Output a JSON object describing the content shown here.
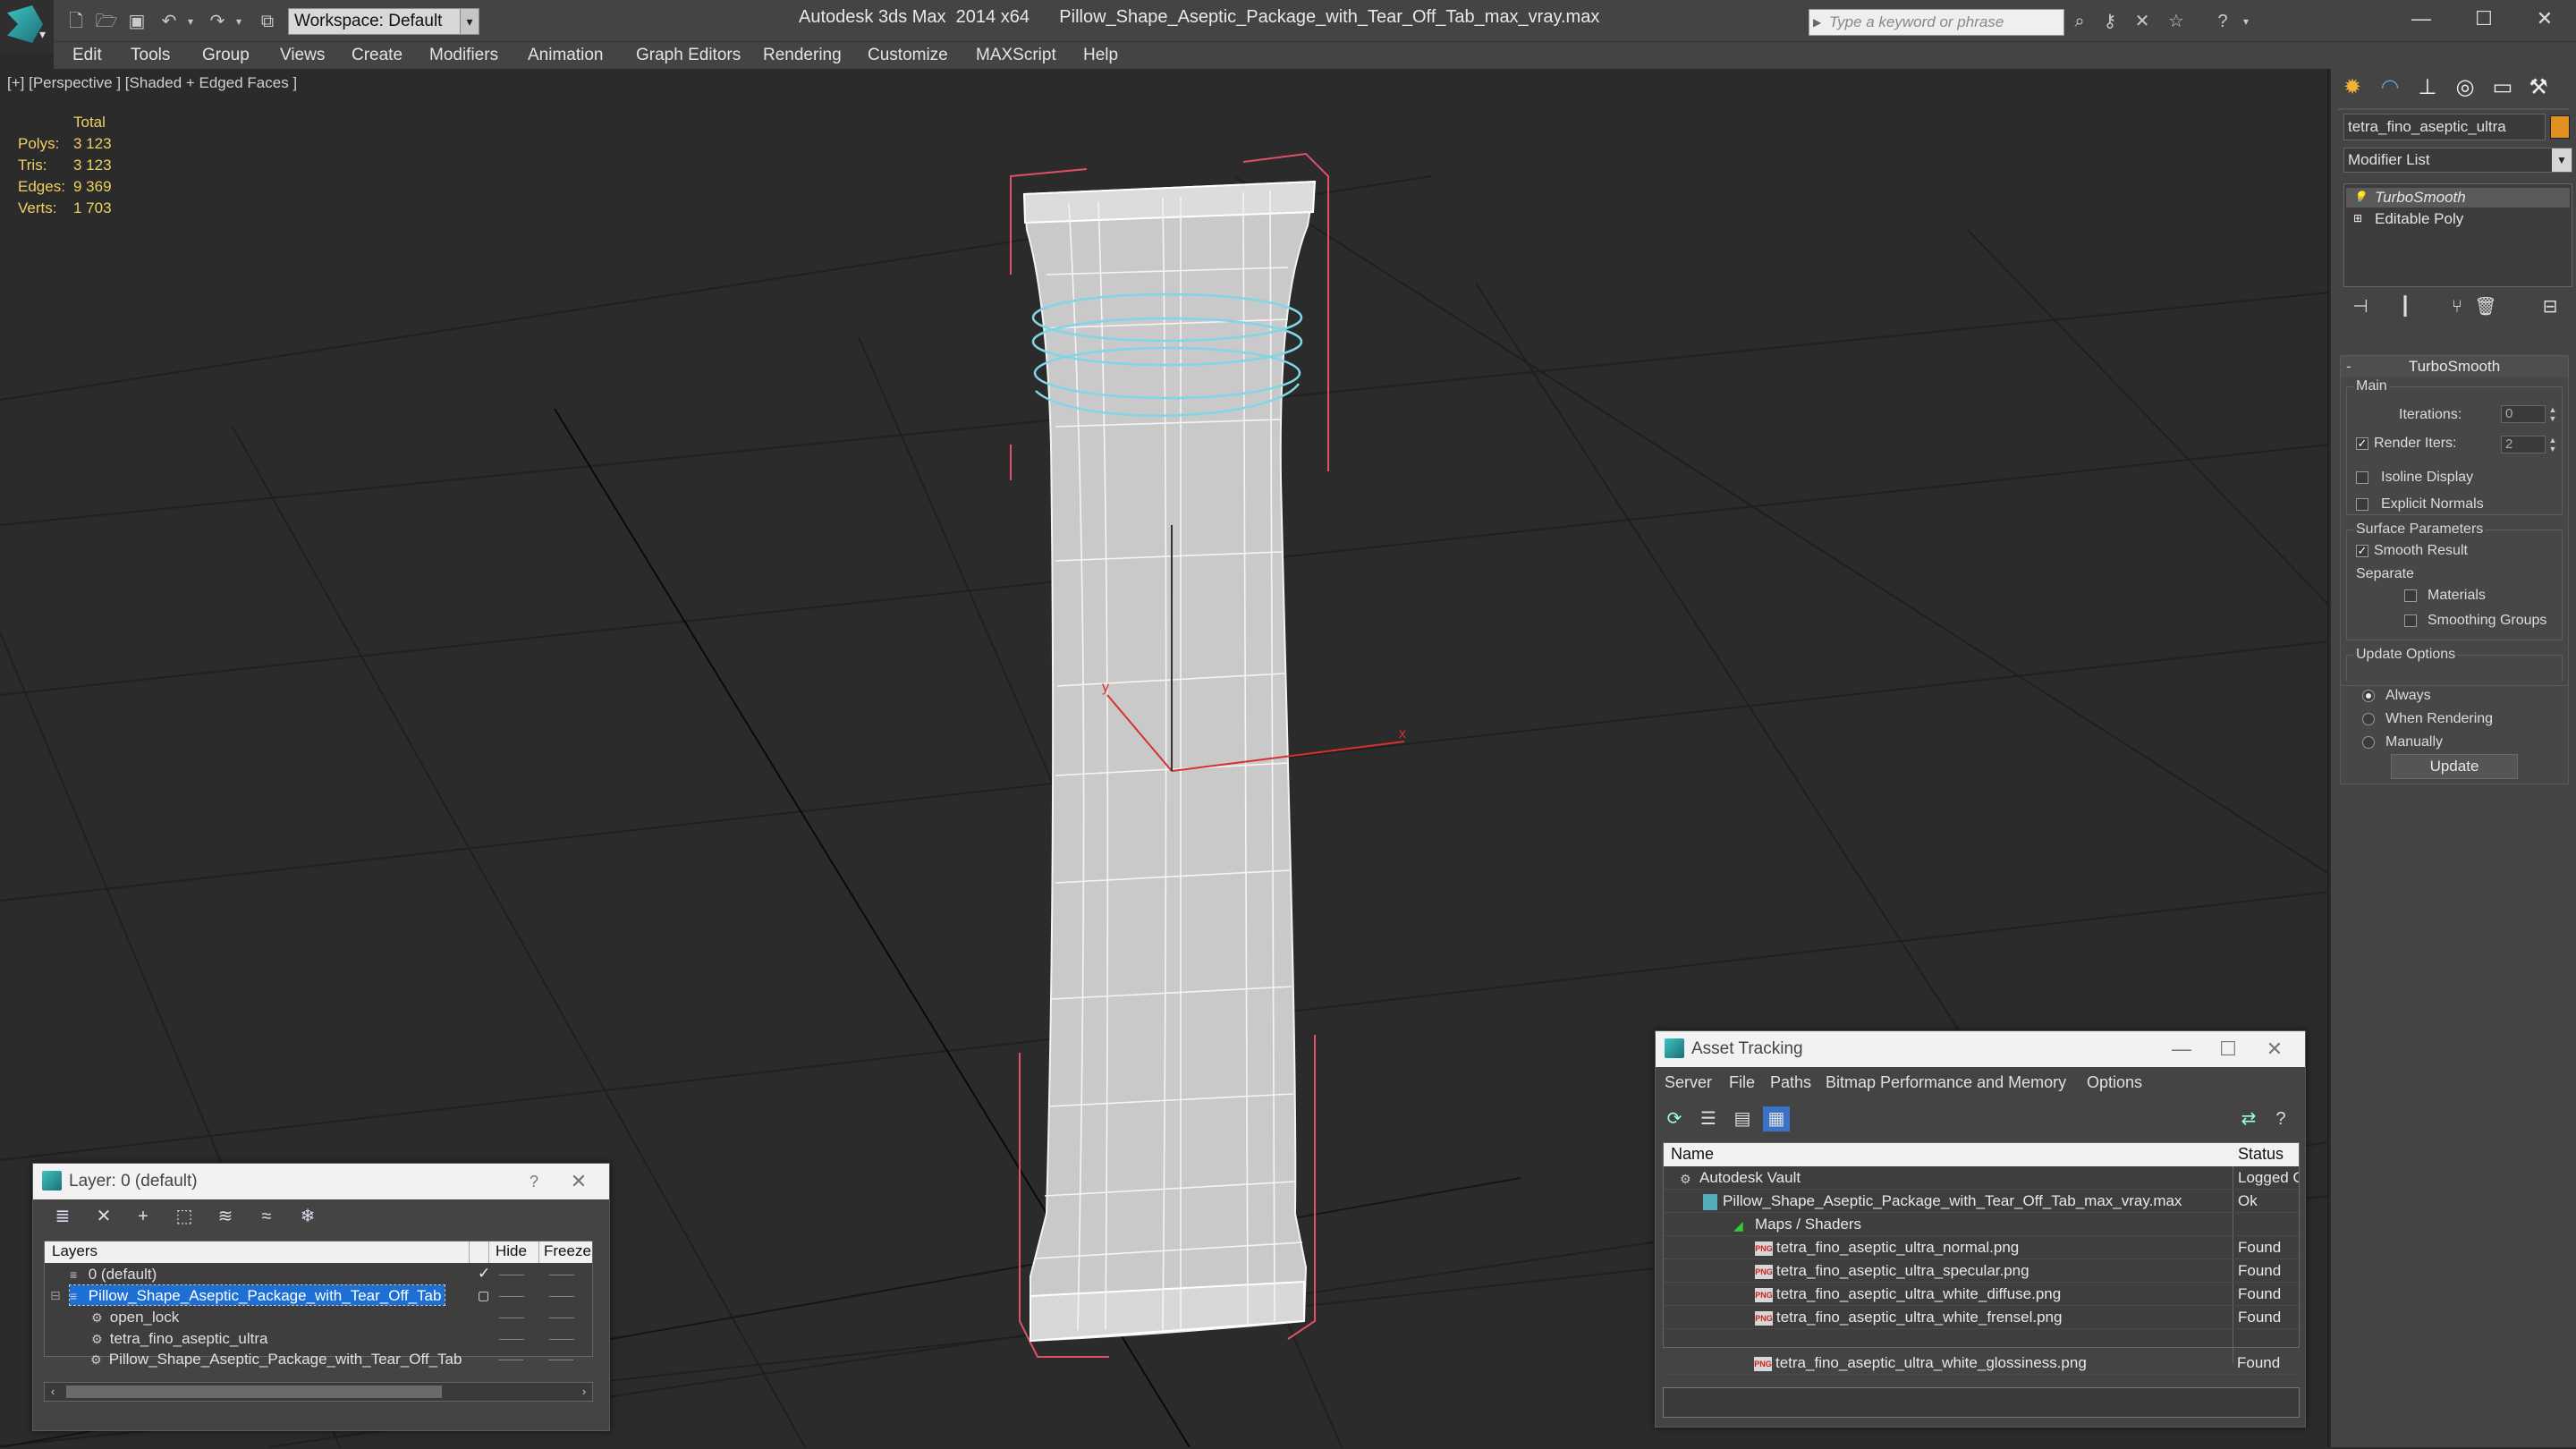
{
  "titlebar": {
    "workspace_label": "Workspace: Default",
    "window_title": "Autodesk 3ds Max  2014 x64      Pillow_Shape_Aseptic_Package_with_Tear_Off_Tab_max_vray.max",
    "search_placeholder": "Type a keyword or phrase",
    "quick_access_icons": [
      "new-icon",
      "open-icon",
      "save-icon",
      "undo-icon",
      "redo-icon",
      "project-icon"
    ],
    "search_tool_icons": [
      "binoculars-icon",
      "key-icon",
      "communication-icon",
      "star-icon",
      "help-icon"
    ],
    "window_controls": {
      "minimize": "—",
      "maximize": "☐",
      "close": "✕"
    }
  },
  "menubar": {
    "items": [
      "Edit",
      "Tools",
      "Group",
      "Views",
      "Create",
      "Modifiers",
      "Animation",
      "Graph Editors",
      "Rendering",
      "Customize",
      "MAXScript",
      "Help"
    ]
  },
  "viewport": {
    "label": "[+] [Perspective ] [Shaded + Edged Faces ]",
    "stats": {
      "header": "Total",
      "rows": [
        {
          "label": "Polys:",
          "value": "3 123"
        },
        {
          "label": "Tris:",
          "value": "3 123"
        },
        {
          "label": "Edges:",
          "value": "9 369"
        },
        {
          "label": "Verts:",
          "value": "1 703"
        }
      ]
    },
    "gizmo_axes": {
      "x": "x",
      "y": "y"
    }
  },
  "command_panel": {
    "tab_icons": [
      "create-icon",
      "modify-icon",
      "hierarchy-icon",
      "motion-icon",
      "display-icon",
      "utilities-icon"
    ],
    "object_name": "tetra_fino_aseptic_ultra",
    "object_color": "#e09020",
    "modifier_list_label": "Modifier List",
    "stack": [
      {
        "name": "TurboSmooth",
        "active": true
      },
      {
        "name": "Editable Poly",
        "active": false
      }
    ],
    "stack_tool_icons": [
      "pin-stack-icon",
      "show-end-result-icon",
      "make-unique-icon",
      "remove-modifier-icon",
      "configure-sets-icon"
    ],
    "turbosmooth": {
      "title": "TurboSmooth",
      "main_group": "Main",
      "iterations_label": "Iterations:",
      "iterations_value": "0",
      "render_iters_label": "Render Iters:",
      "render_iters_value": "2",
      "render_iters_checked": true,
      "isoline_label": "Isoline Display",
      "isoline_checked": false,
      "explicit_normals_label": "Explicit Normals",
      "explicit_normals_checked": false,
      "surface_group": "Surface Parameters",
      "smooth_result_label": "Smooth Result",
      "smooth_result_checked": true,
      "separate_label": "Separate",
      "materials_label": "Materials",
      "materials_checked": false,
      "smoothing_groups_label": "Smoothing Groups",
      "smoothing_groups_checked": false,
      "update_group": "Update Options",
      "update_options": [
        {
          "label": "Always",
          "selected": true
        },
        {
          "label": "When Rendering",
          "selected": false
        },
        {
          "label": "Manually",
          "selected": false
        }
      ],
      "update_button": "Update"
    }
  },
  "layer_dialog": {
    "title": "Layer: 0 (default)",
    "help_glyph": "?",
    "close_glyph": "✕",
    "toolbar_icons": [
      "create-layer-icon",
      "delete-layer-icon",
      "add-to-layer-icon",
      "select-objects-icon",
      "select-layer-icon",
      "hide-all-icon",
      "freeze-all-icon"
    ],
    "columns": [
      "Layers",
      "Hide",
      "Freeze"
    ],
    "rows": [
      {
        "name": "0 (default)",
        "indent": 1,
        "kind": "layer",
        "current": true,
        "selected": false
      },
      {
        "name": "Pillow_Shape_Aseptic_Package_with_Tear_Off_Tab",
        "indent": 1,
        "kind": "layer",
        "current": false,
        "selected": true
      },
      {
        "name": "open_lock",
        "indent": 2,
        "kind": "object",
        "current": false,
        "selected": false
      },
      {
        "name": "tetra_fino_aseptic_ultra",
        "indent": 2,
        "kind": "object",
        "current": false,
        "selected": false
      },
      {
        "name": "Pillow_Shape_Aseptic_Package_with_Tear_Off_Tab",
        "indent": 2,
        "kind": "object",
        "current": false,
        "selected": false
      }
    ],
    "hide_marker": "——",
    "freeze_marker": "——"
  },
  "asset_dialog": {
    "title": "Asset Tracking",
    "menu": [
      "Server",
      "File",
      "Paths",
      "Bitmap Performance and Memory",
      "Options"
    ],
    "toolbar_icons": [
      "refresh-icon",
      "list-view-icon",
      "detail-view-icon",
      "table-view-icon"
    ],
    "right_icons": [
      "vault-connect-icon",
      "help-icon"
    ],
    "columns": [
      "Name",
      "Status"
    ],
    "rows": [
      {
        "name": "Autodesk Vault",
        "status": "Logged O",
        "kind": "vault",
        "indent": 0
      },
      {
        "name": "Pillow_Shape_Aseptic_Package_with_Tear_Off_Tab_max_vray.max",
        "status": "Ok",
        "kind": "file",
        "indent": 1
      },
      {
        "name": "Maps / Shaders",
        "status": "",
        "kind": "maps",
        "indent": 2
      },
      {
        "name": "tetra_fino_aseptic_ultra_normal.png",
        "status": "Found",
        "kind": "png",
        "indent": 3
      },
      {
        "name": "tetra_fino_aseptic_ultra_specular.png",
        "status": "Found",
        "kind": "png",
        "indent": 3
      },
      {
        "name": "tetra_fino_aseptic_ultra_white_diffuse.png",
        "status": "Found",
        "kind": "png",
        "indent": 3
      },
      {
        "name": "tetra_fino_aseptic_ultra_white_frensel.png",
        "status": "Found",
        "kind": "png",
        "indent": 3
      },
      {
        "name": "tetra_fino_aseptic_ultra_white_glossiness.png",
        "status": "Found",
        "kind": "png",
        "indent": 3
      }
    ],
    "png_badge": "PNG"
  }
}
